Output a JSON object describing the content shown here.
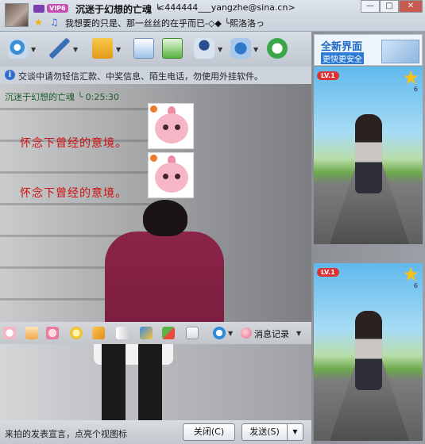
{
  "header": {
    "nickname": "沉迷于幻想的亡魂 ╰",
    "email": "<444444___yangzhe@sina.cn>",
    "vip_badge": "VIP6",
    "signature": "我想要的只是、那一丝丝的在乎而已-◇◆ ╰熙洛洛っ",
    "window_buttons": [
      "—",
      "□",
      "✕"
    ]
  },
  "toolbar": {
    "items": [
      "video-call",
      "voice-call",
      "send-file",
      "send-sms",
      "create-group",
      "remote-assist",
      "app-center",
      "security"
    ]
  },
  "notice": {
    "icon_glyph": "i",
    "text": "交谈中请勿轻信汇款、中奖信息、陌生电话，勿使用外挂软件。"
  },
  "chat": {
    "meta": "沉迷于幻想的亡魂 ╰  0:25:30",
    "messages": [
      {
        "text": "怀念下曾经的意境。"
      },
      {
        "text": "怀念下曾经的意境。"
      }
    ]
  },
  "emoticon_bar": {
    "history_label": "消息记录"
  },
  "bottom": {
    "ad_text": "来拍的发表宣言，点亮个视图标",
    "close_label": "关闭(C)",
    "send_label": "发送(S)",
    "send_arrow": "▼"
  },
  "side_panel": {
    "banner_title": "全新界面",
    "banner_subtitle": "更快更安全",
    "show_cards": [
      {
        "level_badge": "LV.1",
        "star_count": "6"
      },
      {
        "level_badge": "LV.1",
        "star_count": "6"
      }
    ]
  },
  "colors": {
    "message_text": "#d01010",
    "meta_text": "#1c5c2a",
    "accent_blue": "#1b69c3"
  }
}
